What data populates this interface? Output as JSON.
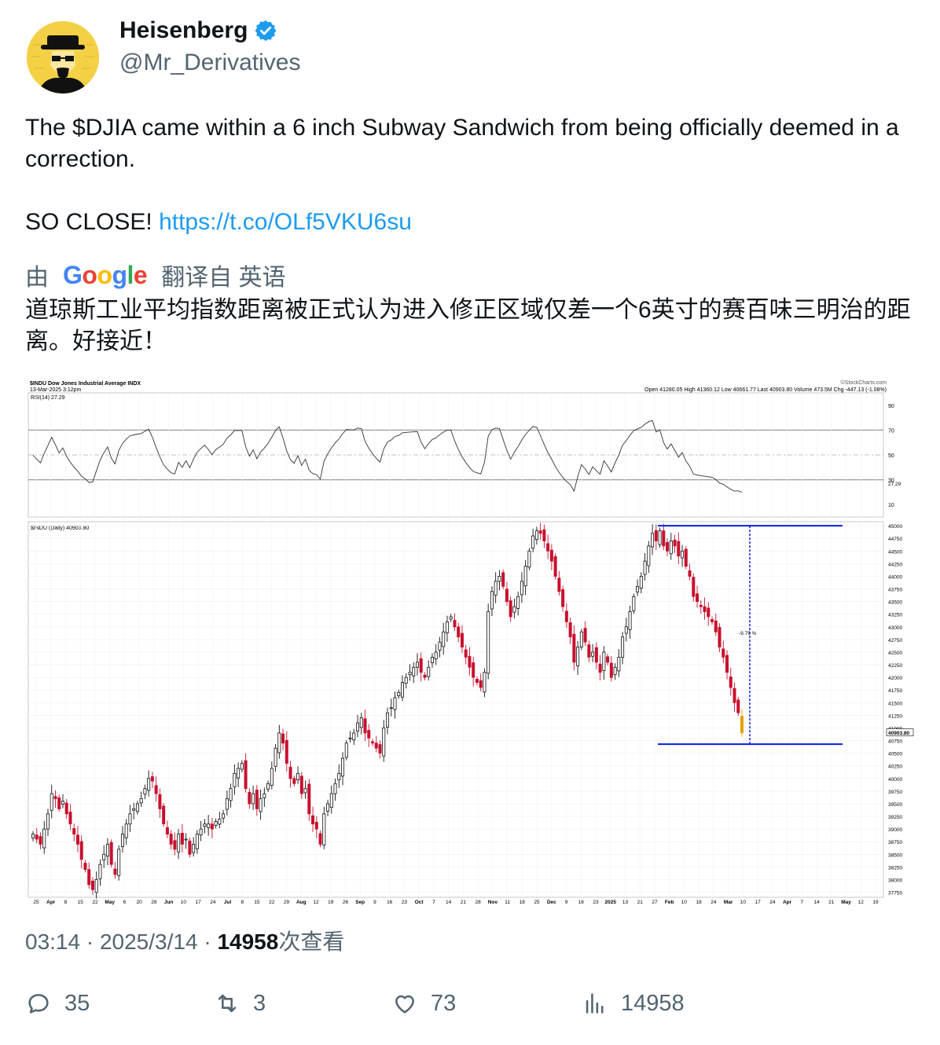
{
  "tweet": {
    "author_name": "Heisenberg",
    "author_handle": "@Mr_Derivatives",
    "text_line1": "The $DJIA came within a 6 inch Subway Sandwich from being officially deemed in a correction.",
    "text_line2_prefix": "SO CLOSE! ",
    "link": "https://t.co/OLf5VKU6su",
    "translate_by": "由",
    "translate_provider": "Google",
    "translate_from": "翻译自 英语",
    "translated_text": "道琼斯工业平均指数距离被正式认为进入修正区域仅差一个6英寸的赛百味三明治的距离。好接近！",
    "time": "03:14",
    "date": "2025/3/14",
    "views": "14958",
    "views_label": "次查看",
    "sep": "·",
    "replies": "35",
    "retweets": "3",
    "likes": "73",
    "view_count_action": "14958"
  },
  "chart_data": {
    "type": "candlestick",
    "title": "$INDU Dow Jones Industrial Average INDX",
    "date_label": "13-Mar-2025 3:12pm",
    "source": "©StockCharts.com",
    "quote": {
      "open": "Open 41280.05",
      "high": "High 41360.12",
      "low": "Low 40661.77",
      "last": "Last 40903.80",
      "volume": "Volume 473.5M",
      "chg": "Chg -447.13 (-1.08%)"
    },
    "rsi_label": "RSI(14) 27.29",
    "rsi_ticks": [
      "90",
      "70",
      "50",
      "30",
      "10"
    ],
    "rsi_last": "27.29",
    "price_label": "$INDU (Daily) 40903.80",
    "price_last": "40903.80",
    "annotation": "-9.79 %",
    "y_ticks": [
      "45000",
      "44750",
      "44500",
      "44250",
      "44000",
      "43750",
      "43500",
      "43250",
      "43000",
      "42750",
      "42500",
      "42250",
      "42000",
      "41750",
      "41500",
      "41250",
      "41000",
      "40750",
      "40500",
      "40250",
      "40000",
      "39750",
      "39500",
      "39250",
      "39000",
      "38750",
      "38500",
      "38250",
      "38000",
      "37750"
    ],
    "ylim": [
      37650,
      45080
    ],
    "x_ticks": [
      "25",
      "Apr",
      "8",
      "15",
      "22",
      "May",
      "6",
      "20",
      "28",
      "Jun",
      "10",
      "17",
      "24",
      "Jul",
      "8",
      "15",
      "22",
      "29",
      "Aug",
      "12",
      "19",
      "26",
      "Sep",
      "9",
      "16",
      "23",
      "Oct",
      "7",
      "14",
      "21",
      "28",
      "Nov",
      "11",
      "18",
      "25",
      "Dec",
      "9",
      "16",
      "23",
      "2025",
      "13",
      "21",
      "27",
      "Feb",
      "10",
      "18",
      "24",
      "Mar",
      "10",
      "17",
      "24",
      "Apr",
      "7",
      "14",
      "21",
      "May",
      "12",
      "19"
    ],
    "close_series": [
      38900,
      38800,
      38700,
      39000,
      39300,
      39700,
      39600,
      39400,
      39550,
      39300,
      39100,
      38900,
      38700,
      38400,
      38200,
      37900,
      37800,
      38000,
      38300,
      38500,
      38700,
      38300,
      38100,
      38600,
      38900,
      39100,
      39300,
      39400,
      39500,
      39600,
      39800,
      40000,
      39950,
      39700,
      39400,
      39100,
      38900,
      38700,
      38600,
      38900,
      38700,
      38800,
      38500,
      38700,
      38900,
      39000,
      39100,
      39100,
      39000,
      39150,
      39200,
      39300,
      39600,
      39800,
      40100,
      40200,
      40300,
      39800,
      39500,
      39700,
      39400,
      39600,
      39700,
      39900,
      40200,
      40600,
      40900,
      40700,
      40300,
      40000,
      39900,
      40100,
      39700,
      39800,
      39300,
      39100,
      39000,
      38700,
      39300,
      39500,
      39700,
      39900,
      40100,
      40400,
      40700,
      40800,
      40900,
      41100,
      41200,
      40900,
      40800,
      40700,
      40600,
      40500,
      41000,
      41300,
      41400,
      41600,
      41700,
      41900,
      42000,
      42100,
      42200,
      42300,
      42100,
      42000,
      42200,
      42400,
      42500,
      42700,
      42900,
      43100,
      43200,
      43000,
      42800,
      42600,
      42400,
      42200,
      42000,
      41900,
      41800,
      42100,
      43300,
      43700,
      43900,
      44000,
      43800,
      43500,
      43200,
      43400,
      43600,
      43900,
      44200,
      44500,
      44800,
      44900,
      44850,
      44700,
      44500,
      44300,
      44000,
      43700,
      43400,
      43100,
      42800,
      42300,
      42600,
      42900,
      42700,
      42400,
      42500,
      42300,
      42100,
      42500,
      42300,
      42000,
      42200,
      42400,
      42800,
      43000,
      43300,
      43600,
      43800,
      44000,
      44300,
      44600,
      44850,
      44700,
      44900,
      44600,
      44500,
      44700,
      44600,
      44400,
      44500,
      44200,
      44000,
      43600,
      43500,
      43400,
      43300,
      43200,
      43100,
      42900,
      42600,
      42400,
      42100,
      41800,
      41500,
      41300,
      40904
    ]
  }
}
